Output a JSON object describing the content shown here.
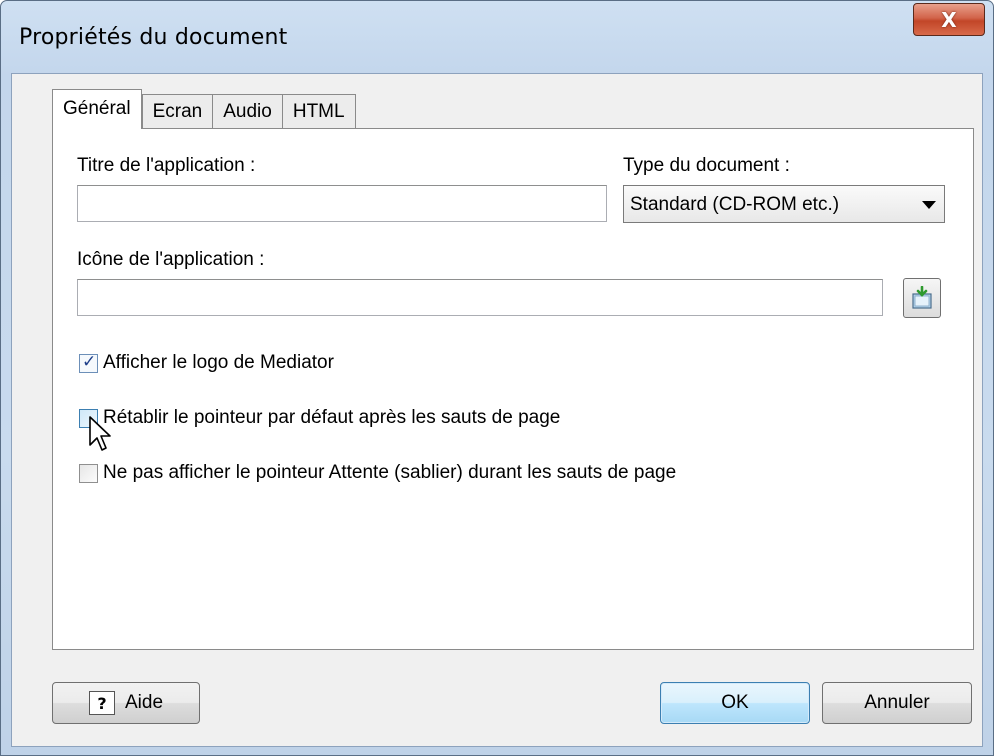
{
  "window": {
    "title": "Propriétés du document",
    "close_glyph": "X"
  },
  "tabs": [
    {
      "label": "Général",
      "active": true
    },
    {
      "label": "Ecran",
      "active": false
    },
    {
      "label": "Audio",
      "active": false
    },
    {
      "label": "HTML",
      "active": false
    }
  ],
  "general": {
    "app_title_label": "Titre de l'application :",
    "app_title_value": "",
    "doc_type_label": "Type du document :",
    "doc_type_selected": "Standard (CD-ROM etc.)",
    "app_icon_label": "Icône de l'application :",
    "app_icon_value": "",
    "checkboxes": [
      {
        "label": "Afficher le logo de Mediator",
        "checked": true
      },
      {
        "label": "Rétablir le pointeur par défaut après les sauts de page",
        "checked": false
      },
      {
        "label": "Ne pas afficher le pointeur Attente (sablier) durant les sauts de page",
        "checked": false
      }
    ]
  },
  "buttons": {
    "help": "Aide",
    "help_icon_glyph": "?",
    "ok": "OK",
    "cancel": "Annuler"
  },
  "colors": {
    "title_bar": "#c9dbee",
    "close_button": "#c24628",
    "default_button": "#bee6fd"
  }
}
